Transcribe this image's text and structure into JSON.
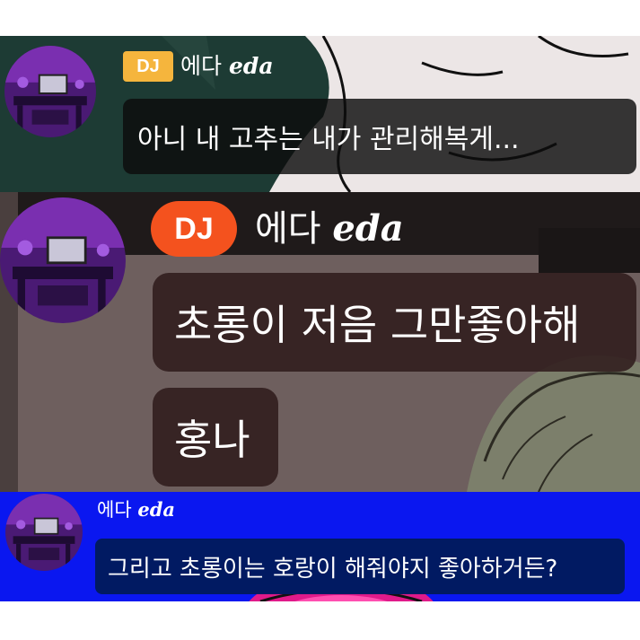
{
  "colors": {
    "panel1_bg": "#1d3b34",
    "panel2_bg": "#6b5d5c",
    "panel3_bg": "#0a17f0",
    "dj_badge_yellow": "#f5b53d",
    "dj_badge_orange": "#f4521e",
    "bubble_dark": "#111111",
    "bubble_navy": "#011a62",
    "text": "#ffffff"
  },
  "panel1": {
    "badge": "DJ",
    "name": "에다",
    "name_en": "eda",
    "message": "아니 내 고추는 내가 관리해복게..."
  },
  "panel2": {
    "badge": "DJ",
    "name": "에다",
    "name_en": "eda",
    "messages": [
      "초롱이 저음 그만좋아해",
      "홍나"
    ]
  },
  "panel3": {
    "name": "에다",
    "name_en": "eda",
    "message": "그리고 초롱이는 호랑이 해줘야지 좋아하거든?"
  }
}
